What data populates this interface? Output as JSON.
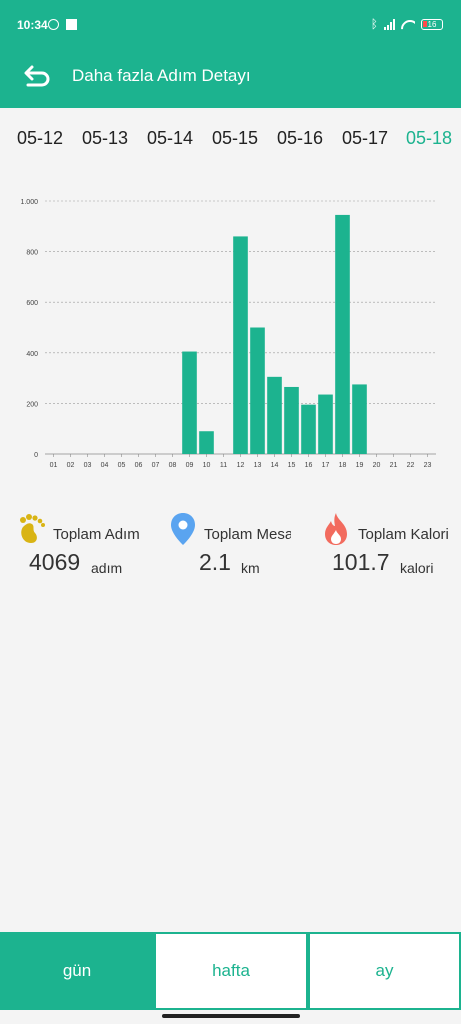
{
  "status_bar": {
    "time": "10:34",
    "battery": "16",
    "bluetooth_icon": "bluetooth-icon"
  },
  "app_bar": {
    "title": "Daha fazla Adım Detayı",
    "back_icon": "back-arrow-icon"
  },
  "dates": [
    {
      "label": "05-12",
      "active": false
    },
    {
      "label": "05-13",
      "active": false
    },
    {
      "label": "05-14",
      "active": false
    },
    {
      "label": "05-15",
      "active": false
    },
    {
      "label": "05-16",
      "active": false
    },
    {
      "label": "05-17",
      "active": false
    },
    {
      "label": "05-18",
      "active": true
    }
  ],
  "colors": {
    "accent": "#1cb38f",
    "bar": "#1cb38f"
  },
  "chart_data": {
    "type": "bar",
    "categories": [
      "01",
      "02",
      "03",
      "04",
      "05",
      "06",
      "07",
      "08",
      "09",
      "10",
      "11",
      "12",
      "13",
      "14",
      "15",
      "16",
      "17",
      "18",
      "19",
      "20",
      "21",
      "22",
      "23"
    ],
    "values": [
      0,
      0,
      0,
      0,
      0,
      0,
      0,
      0,
      405,
      90,
      0,
      860,
      500,
      305,
      265,
      195,
      235,
      945,
      275,
      0,
      0,
      0,
      0
    ],
    "yticks": [
      "0",
      "200",
      "400",
      "600",
      "800",
      "1.000"
    ],
    "ylim": [
      0,
      1000
    ],
    "grid": true
  },
  "stats": [
    {
      "icon": "footprints-icon",
      "label": "Toplam Adım",
      "value": "4069",
      "unit": "adım"
    },
    {
      "icon": "location-pin-icon",
      "label": "Toplam Mesafe",
      "value": "2.1",
      "unit": "km"
    },
    {
      "icon": "flame-icon",
      "label": "Toplam Kalori",
      "value": "101.7",
      "unit": "kalori"
    }
  ],
  "tabs": [
    {
      "label": "gün",
      "active": true
    },
    {
      "label": "hafta",
      "active": false
    },
    {
      "label": "ay",
      "active": false
    }
  ]
}
